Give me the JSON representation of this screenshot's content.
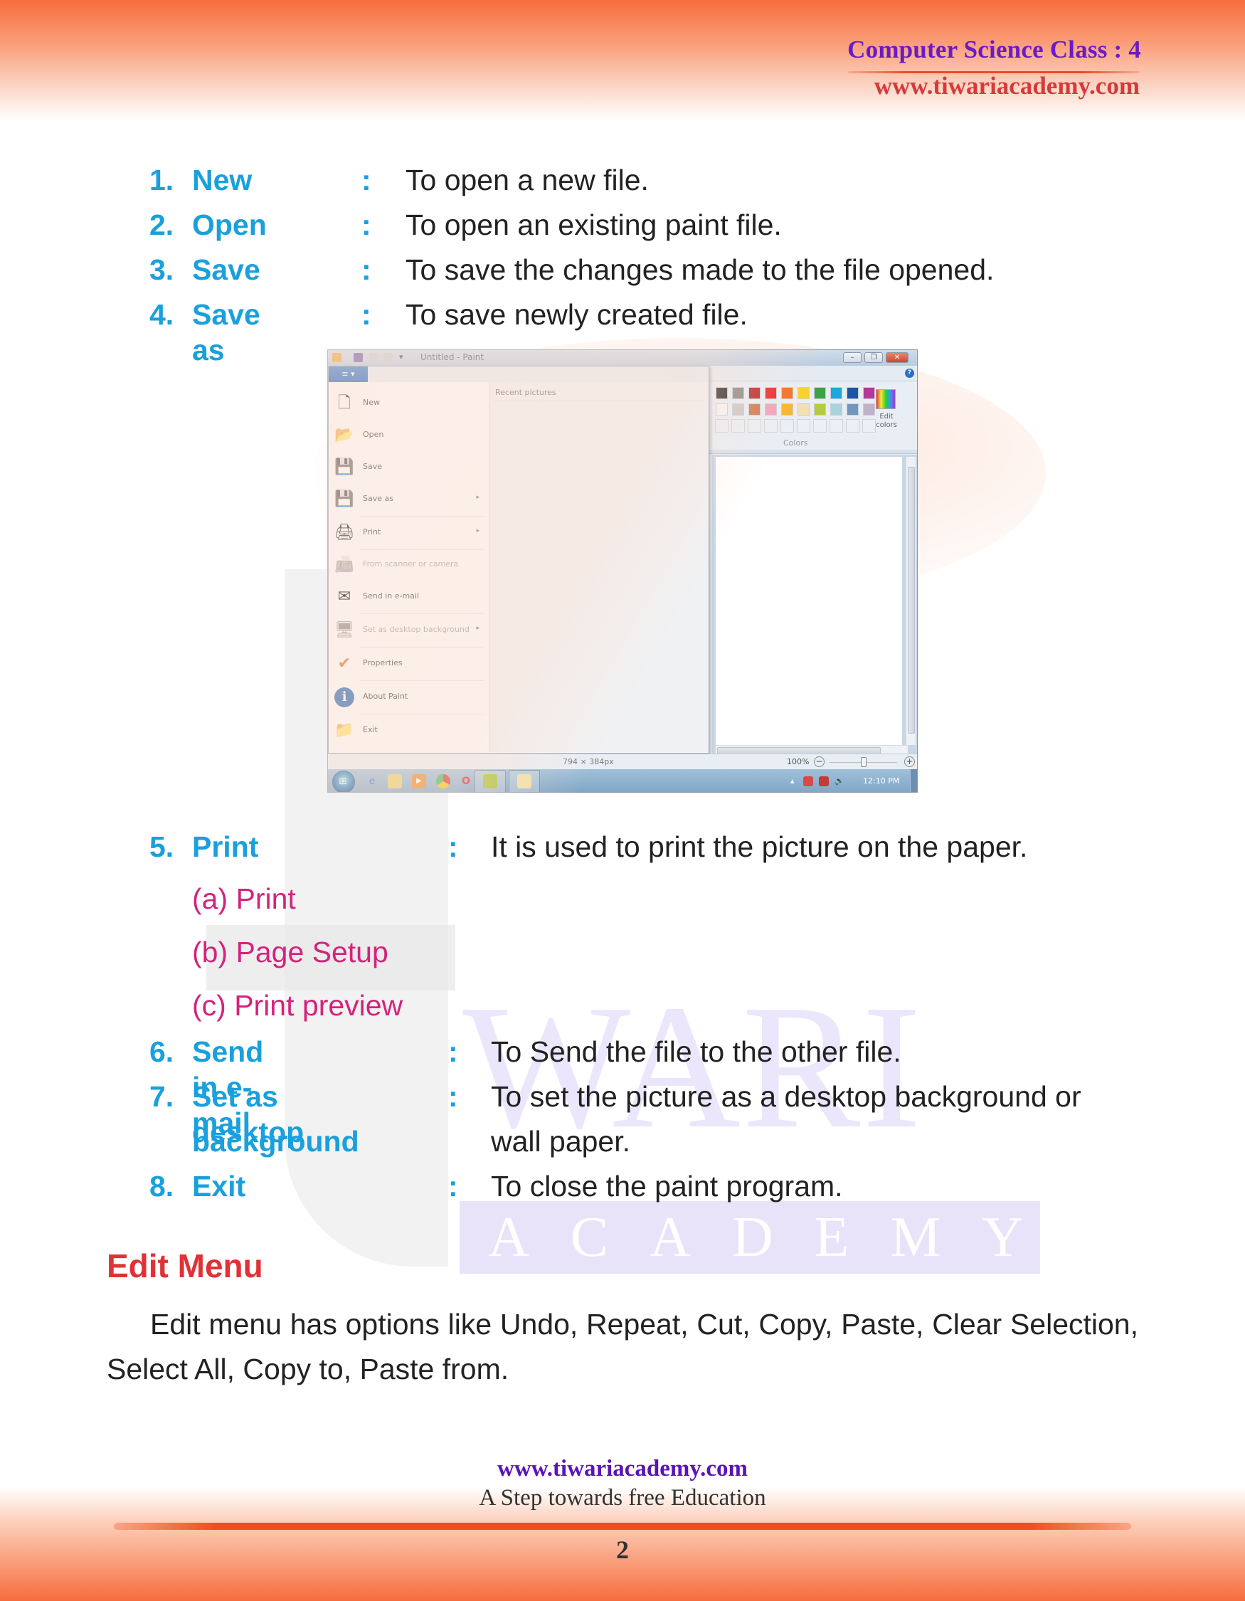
{
  "header": {
    "title": "Computer Science Class : 4",
    "url": "www.tiwariacademy.com"
  },
  "watermark": {
    "word1": "WARI",
    "word2": "ACADEMY"
  },
  "file_menu_items_top": [
    {
      "num": "1.",
      "term": "New",
      "colon": ":",
      "desc": "To open a new file."
    },
    {
      "num": "2.",
      "term": "Open",
      "colon": ":",
      "desc": "To open an existing paint file."
    },
    {
      "num": "3.",
      "term": "Save",
      "colon": ":",
      "desc": "To save the changes made to the file opened."
    },
    {
      "num": "4.",
      "term": "Save as",
      "colon": ":",
      "desc": "To save newly created file."
    }
  ],
  "screenshot": {
    "window_title": "Untitled - Paint",
    "buttons": {
      "minimize": "–",
      "maximize": "❐",
      "close": "✕",
      "help": "?",
      "file_tab": "≡ ▾"
    },
    "recent_title": "Recent pictures",
    "menu": [
      {
        "label": "New",
        "icon": "new-file-icon",
        "glyph": "🗋",
        "arrow": false,
        "disabled": false
      },
      {
        "label": "Open",
        "icon": "open-folder-icon",
        "glyph": "📂",
        "arrow": false,
        "disabled": false
      },
      {
        "label": "Save",
        "icon": "save-disk-icon",
        "glyph": "💾",
        "arrow": false,
        "disabled": false
      },
      {
        "label": "Save as",
        "icon": "save-as-icon",
        "glyph": "💾",
        "arrow": true,
        "disabled": false
      },
      {
        "label": "Print",
        "icon": "printer-icon",
        "glyph": "🖨",
        "arrow": true,
        "disabled": false
      },
      {
        "label": "From scanner or camera",
        "icon": "scanner-icon",
        "glyph": "📠",
        "arrow": false,
        "disabled": true
      },
      {
        "label": "Send in e-mail",
        "icon": "email-icon",
        "glyph": "✉",
        "arrow": false,
        "disabled": false
      },
      {
        "label": "Set as desktop background",
        "icon": "desktop-background-icon",
        "glyph": "🖥",
        "arrow": true,
        "disabled": true
      },
      {
        "label": "Properties",
        "icon": "checkmark-icon",
        "glyph": "✔",
        "arrow": false,
        "disabled": false
      },
      {
        "label": "About Paint",
        "icon": "info-icon",
        "glyph": "ℹ",
        "arrow": false,
        "disabled": false
      },
      {
        "label": "Exit",
        "icon": "exit-icon",
        "glyph": "📁",
        "arrow": false,
        "disabled": false
      }
    ],
    "arrow_glyph": "▸",
    "palette_row1": [
      "#2b2222",
      "#8a8585",
      "#b52a2a",
      "#e82a2a",
      "#f07023",
      "#f8d12a",
      "#3fa346",
      "#1ea6dd",
      "#1a55a6",
      "#b03a9a"
    ],
    "palette_row2": [
      "#f7f3f3",
      "#cdc5c5",
      "#cf7a4a",
      "#f3a3b7",
      "#f7b52a",
      "#f2e0b0",
      "#b5cc3a",
      "#a9d4dc",
      "#7196bf",
      "#c0b0c8"
    ],
    "edit_colors": "Edit colors",
    "colors_group": "Colors",
    "status_size": "794 × 384px",
    "zoom": "100%",
    "zoom_fraction": 0.5,
    "clock": "12:10 PM",
    "tray": "▴"
  },
  "file_menu_items_bottom": {
    "print": {
      "num": "5.",
      "term": "Print",
      "colon": ":",
      "desc": "It is used to print the picture on the paper."
    },
    "print_sub": [
      "(a) Print",
      "(b) Page Setup",
      "(c) Print preview"
    ],
    "rest": [
      {
        "num": "6.",
        "term": "Send in e-mail",
        "colon": ":",
        "desc": "To Send the file to the other file."
      },
      {
        "num": "7.",
        "term": "Set as desktop",
        "term2": "background",
        "colon": ":",
        "desc": "To set the picture as a desktop background or",
        "desc2": "wall paper."
      },
      {
        "num": "8.",
        "term": "Exit",
        "colon": ":",
        "desc": "To close the paint program."
      }
    ]
  },
  "edit_menu": {
    "heading": "Edit Menu",
    "paragraph": "Edit menu has options like Undo, Repeat, Cut, Copy, Paste, Clear Selection, Select All, Copy to, Paste from."
  },
  "footer": {
    "url": "www.tiwariacademy.com",
    "tagline": "A Step towards free Education",
    "page_number": "2"
  }
}
